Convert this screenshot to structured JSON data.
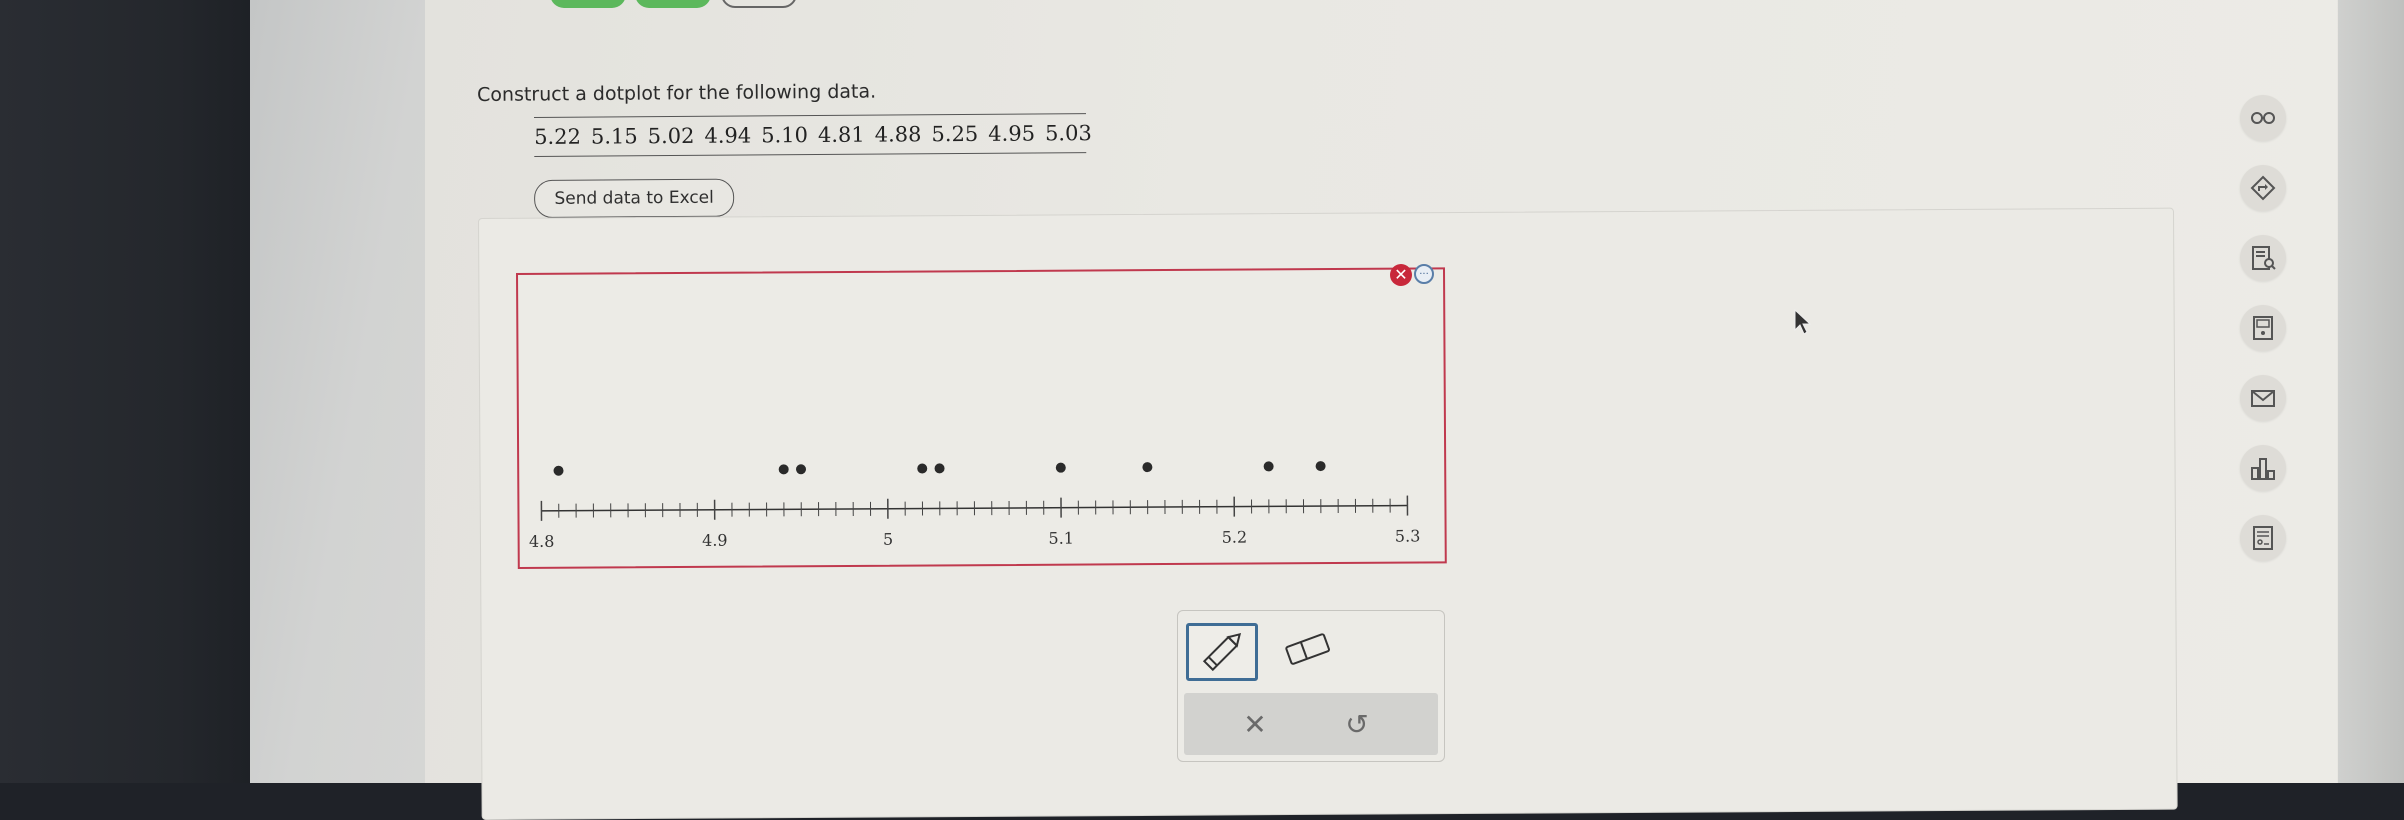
{
  "question": {
    "prompt": "Construct a dotplot for the following data.",
    "data_values": [
      "5.22",
      "5.15",
      "5.02",
      "4.94",
      "5.10",
      "4.81",
      "4.88",
      "5.25",
      "4.95",
      "5.03"
    ],
    "send_button_label": "Send data to Excel"
  },
  "plot": {
    "axis_min": 4.8,
    "axis_max": 5.3,
    "minor_step": 0.01,
    "major_ticks": [
      "4.8",
      "4.9",
      "5",
      "5.1",
      "5.2",
      "5.3"
    ],
    "plotted_dots": [
      4.81,
      4.94,
      4.95,
      5.02,
      5.03,
      5.1,
      5.15,
      5.22,
      5.25
    ]
  },
  "plot_controls": {
    "close_symbol": "✕",
    "more_symbol": "···"
  },
  "toolbar": {
    "clear_symbol": "✕",
    "undo_symbol": "↺"
  },
  "side_toolbar": {
    "icons": [
      "glasses-icon",
      "compass-icon",
      "list-search-icon",
      "calculator-icon",
      "mail-icon",
      "bar-chart-icon",
      "report-icon"
    ]
  },
  "colors": {
    "accent_red": "#c0394e",
    "accent_blue": "#3f6d95",
    "button_green": "#5cb85c"
  }
}
